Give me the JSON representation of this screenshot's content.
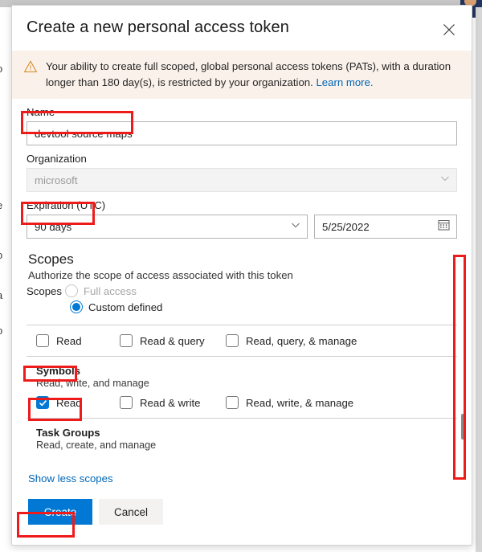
{
  "dialog": {
    "title": "Create a new personal access token",
    "close_icon": "close-icon"
  },
  "warning": {
    "icon": "warning-triangle-icon",
    "text": "Your ability to create full scoped, global personal access tokens (PATs), with a duration longer than 180 day(s), is restricted by your organization.",
    "link_label": "Learn more."
  },
  "form": {
    "name": {
      "label": "Name",
      "value": "devtool source maps"
    },
    "organization": {
      "label": "Organization",
      "value": "microsoft",
      "disabled": "true",
      "chevron_icon": "chevron-down-icon"
    },
    "expiration": {
      "label": "Expiration (UTC)",
      "preset_value": "90 days",
      "chevron_icon": "chevron-down-icon",
      "date_value": "5/25/2022",
      "calendar_icon": "calendar-icon"
    }
  },
  "scopes": {
    "heading": "Scopes",
    "subheading": "Authorize the scope of access associated with this token",
    "radio_group_label": "Scopes",
    "options": [
      {
        "label": "Full access",
        "selected": false,
        "disabled": true
      },
      {
        "label": "Custom defined",
        "selected": true,
        "disabled": false
      }
    ],
    "blocks": [
      {
        "name": "",
        "desc": "",
        "checkboxes": [
          {
            "label": "Read",
            "checked": false
          },
          {
            "label": "Read & query",
            "checked": false
          },
          {
            "label": "Read, query, & manage",
            "checked": false
          }
        ]
      },
      {
        "name": "Symbols",
        "desc": "Read, write, and manage",
        "checkboxes": [
          {
            "label": "Read",
            "checked": true
          },
          {
            "label": "Read & write",
            "checked": false
          },
          {
            "label": "Read, write, & manage",
            "checked": false
          }
        ]
      },
      {
        "name": "Task Groups",
        "desc": "Read, create, and manage",
        "checkboxes": []
      }
    ],
    "show_link": "Show less scopes"
  },
  "footer": {
    "create_label": "Create",
    "cancel_label": "Cancel"
  },
  "background": {
    "fragments": [
      "o",
      ")",
      "e",
      "o",
      ")",
      "a",
      "o",
      ")"
    ]
  },
  "colors": {
    "accent": "#0078d4",
    "link": "#0067b8",
    "warning_bg": "#faf1ea",
    "warning_icon": "#d98f2a",
    "annotation": "#ee1b1b"
  }
}
